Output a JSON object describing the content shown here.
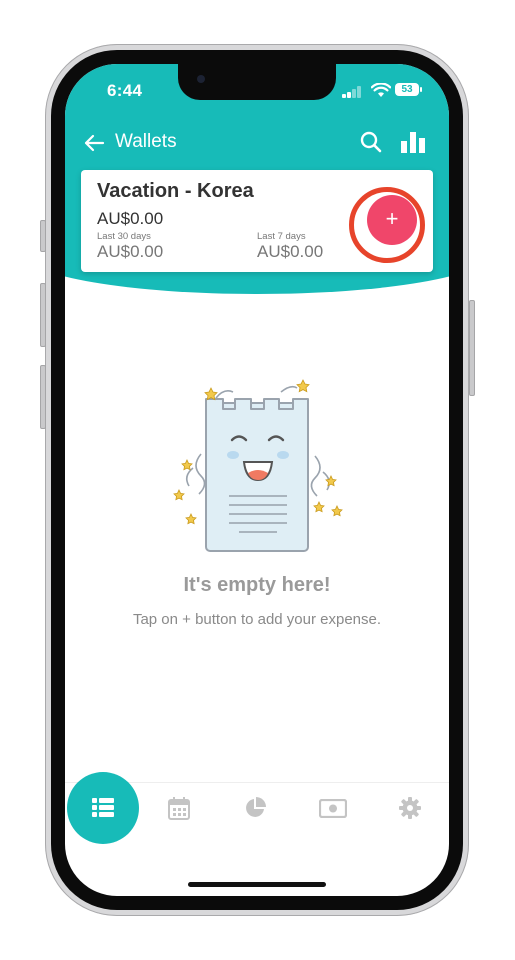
{
  "status_bar": {
    "time": "6:44",
    "battery": "53"
  },
  "header": {
    "title": "Wallets",
    "back_icon": "arrow-left-icon",
    "search_icon": "search-icon",
    "stats_icon": "bar-chart-icon"
  },
  "wallet_card": {
    "name": "Vacation - Korea",
    "balance": "AU$0.00",
    "periods": [
      {
        "label": "Last 30 days",
        "value": "AU$0.00"
      },
      {
        "label": "Last 7 days",
        "value": "AU$0.00"
      }
    ],
    "add_button_label": "+"
  },
  "empty_state": {
    "title": "It's empty here!",
    "subtitle": "Tap on + button to add your expense."
  },
  "bottom_nav": {
    "items": [
      {
        "icon": "list-icon",
        "active": true
      },
      {
        "icon": "calendar-icon",
        "active": false
      },
      {
        "icon": "pie-chart-icon",
        "active": false
      },
      {
        "icon": "cash-icon",
        "active": false
      },
      {
        "icon": "gear-icon",
        "active": false
      }
    ]
  },
  "colors": {
    "accent": "#17bbb8",
    "add_button": "#f0466a",
    "highlight_ring": "#e7442b"
  }
}
